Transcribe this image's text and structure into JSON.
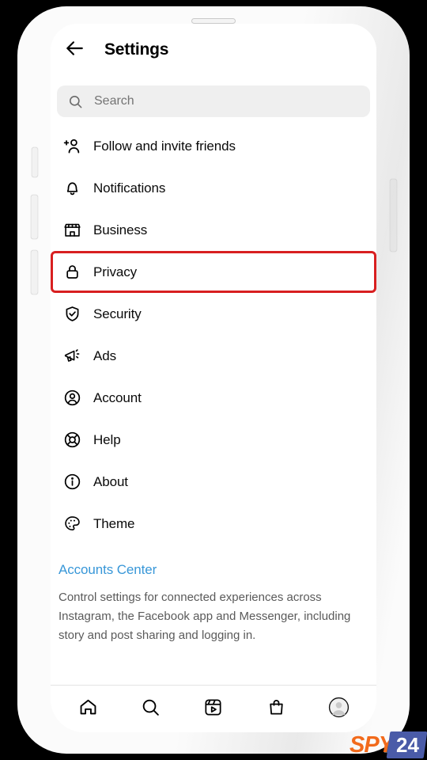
{
  "device": {
    "frame_color": "#fbfbfb",
    "background_color": "#000000"
  },
  "header": {
    "back_icon": "arrow-left-icon",
    "title": "Settings"
  },
  "search": {
    "icon": "search-icon",
    "value": "",
    "placeholder": "Search",
    "background_color": "#efefef"
  },
  "menu": {
    "highlight_color": "#d81f20",
    "items": [
      {
        "id": "follow-and-invite-friends",
        "label": "Follow and invite friends",
        "icon": "person-add-icon",
        "highlighted": false
      },
      {
        "id": "notifications",
        "label": "Notifications",
        "icon": "bell-icon",
        "highlighted": false
      },
      {
        "id": "business",
        "label": "Business",
        "icon": "storefront-icon",
        "highlighted": false
      },
      {
        "id": "privacy",
        "label": "Privacy",
        "icon": "lock-icon",
        "highlighted": true
      },
      {
        "id": "security",
        "label": "Security",
        "icon": "shield-check-icon",
        "highlighted": false
      },
      {
        "id": "ads",
        "label": "Ads",
        "icon": "megaphone-icon",
        "highlighted": false
      },
      {
        "id": "account",
        "label": "Account",
        "icon": "user-circle-icon",
        "highlighted": false
      },
      {
        "id": "help",
        "label": "Help",
        "icon": "lifebuoy-icon",
        "highlighted": false
      },
      {
        "id": "about",
        "label": "About",
        "icon": "info-circle-icon",
        "highlighted": false
      },
      {
        "id": "theme",
        "label": "Theme",
        "icon": "palette-icon",
        "highlighted": false
      }
    ]
  },
  "accounts_center": {
    "link_label": "Accounts Center",
    "link_color": "#3897d8",
    "description": "Control settings for connected experiences across Instagram, the Facebook app and Messenger, including story and post sharing and logging in."
  },
  "tabbar": {
    "tabs": [
      {
        "id": "home",
        "icon": "home-icon"
      },
      {
        "id": "search",
        "icon": "search-icon"
      },
      {
        "id": "reels",
        "icon": "reels-icon"
      },
      {
        "id": "shop",
        "icon": "shopping-bag-icon"
      },
      {
        "id": "profile",
        "icon": "avatar-icon"
      }
    ]
  },
  "watermark": {
    "text_primary": "SPY",
    "text_secondary": "24",
    "primary_color": "#f26a1b",
    "secondary_bg": "#4a5ba8"
  }
}
